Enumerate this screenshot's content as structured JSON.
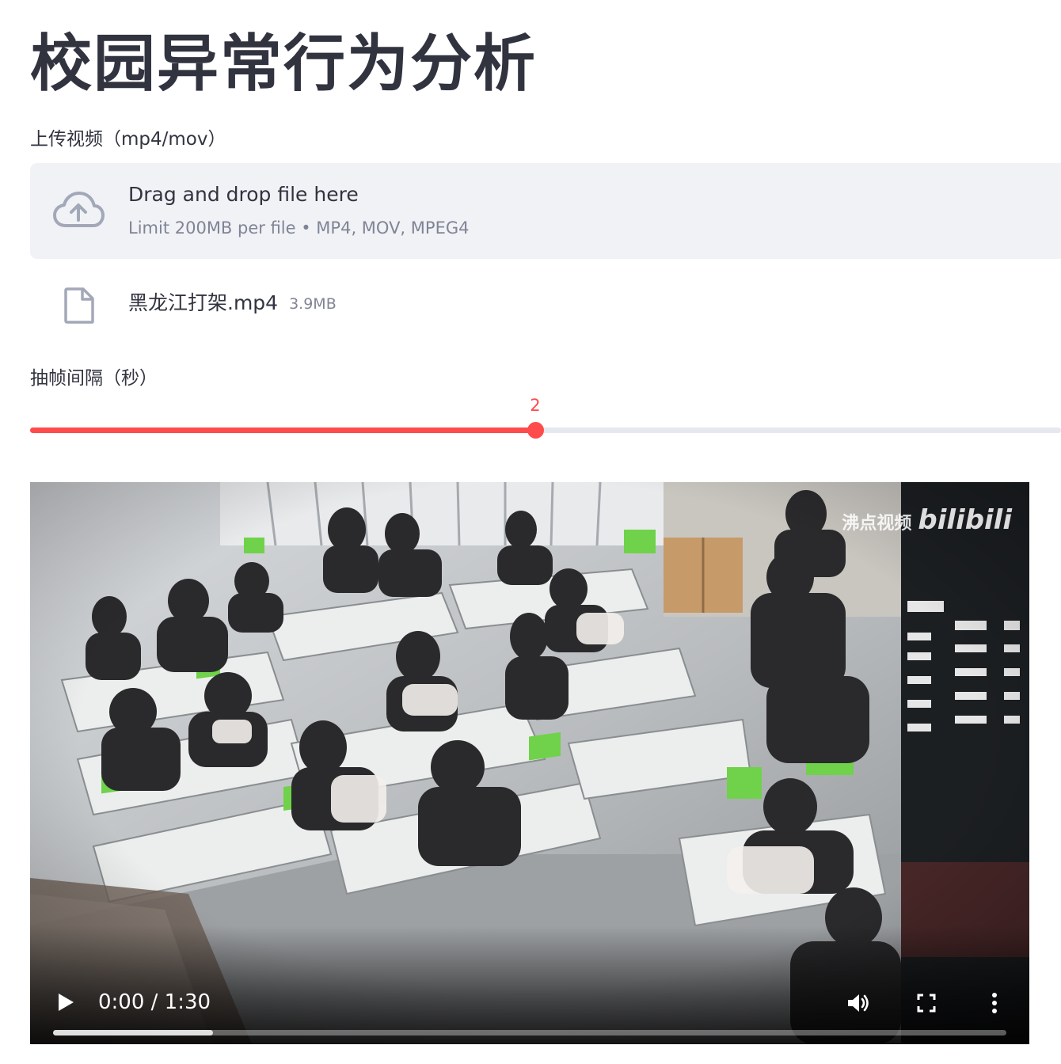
{
  "page": {
    "title": "校园异常行为分析"
  },
  "uploader": {
    "label": "上传视频（mp4/mov）",
    "drop_title": "Drag and drop file here",
    "drop_limit": "Limit 200MB per file • MP4, MOV, MPEG4",
    "icon": "cloud-upload-icon"
  },
  "uploaded_file": {
    "name": "黑龙江打架.mp4",
    "size": "3.9MB",
    "icon": "file-icon"
  },
  "slider": {
    "label": "抽帧间隔（秒）",
    "value": "2",
    "fraction": 0.49,
    "accent": "#ff4b4b",
    "track_color": "#e6e8ef"
  },
  "video": {
    "watermark_text": "沸点视频",
    "watermark_brand": "bilibili",
    "time": "0:00 / 1:30",
    "buffered_fraction": 0.168,
    "icons": [
      "play-icon",
      "volume-icon",
      "fullscreen-icon",
      "more-options-icon"
    ]
  },
  "colors": {
    "text": "#31333f",
    "muted": "#808495",
    "dropzone_bg": "#f0f2f6",
    "icon": "#a3a8b8"
  }
}
